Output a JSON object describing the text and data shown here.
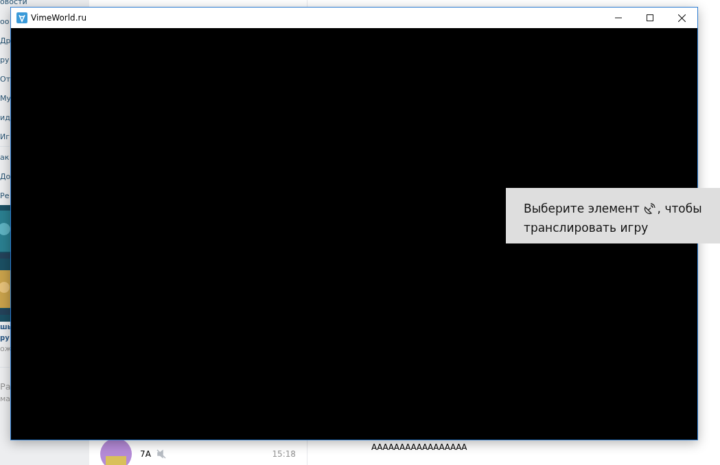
{
  "background_page": {
    "sidebar": {
      "menu_top": [
        "овости",
        "оо",
        "Др",
        "ру",
        "От",
        "Му",
        "ид",
        "Иг"
      ],
      "menu_bottom": [
        "ак",
        "До",
        "Ре"
      ],
      "ad": {
        "line_1": "шь",
        "line_2": "ру",
        "line_3": "ож"
      },
      "footer": [
        "Ра",
        "ма"
      ]
    },
    "chat_row": {
      "name": "7А",
      "muted": true,
      "time": "15:18"
    },
    "message": "ААААААААААААААААА"
  },
  "window": {
    "title": "VimeWorld.ru"
  },
  "toast": {
    "line_1": "Выберите элемент",
    "line_1_end": ", чтобы",
    "line_2": "транслировать игру"
  }
}
